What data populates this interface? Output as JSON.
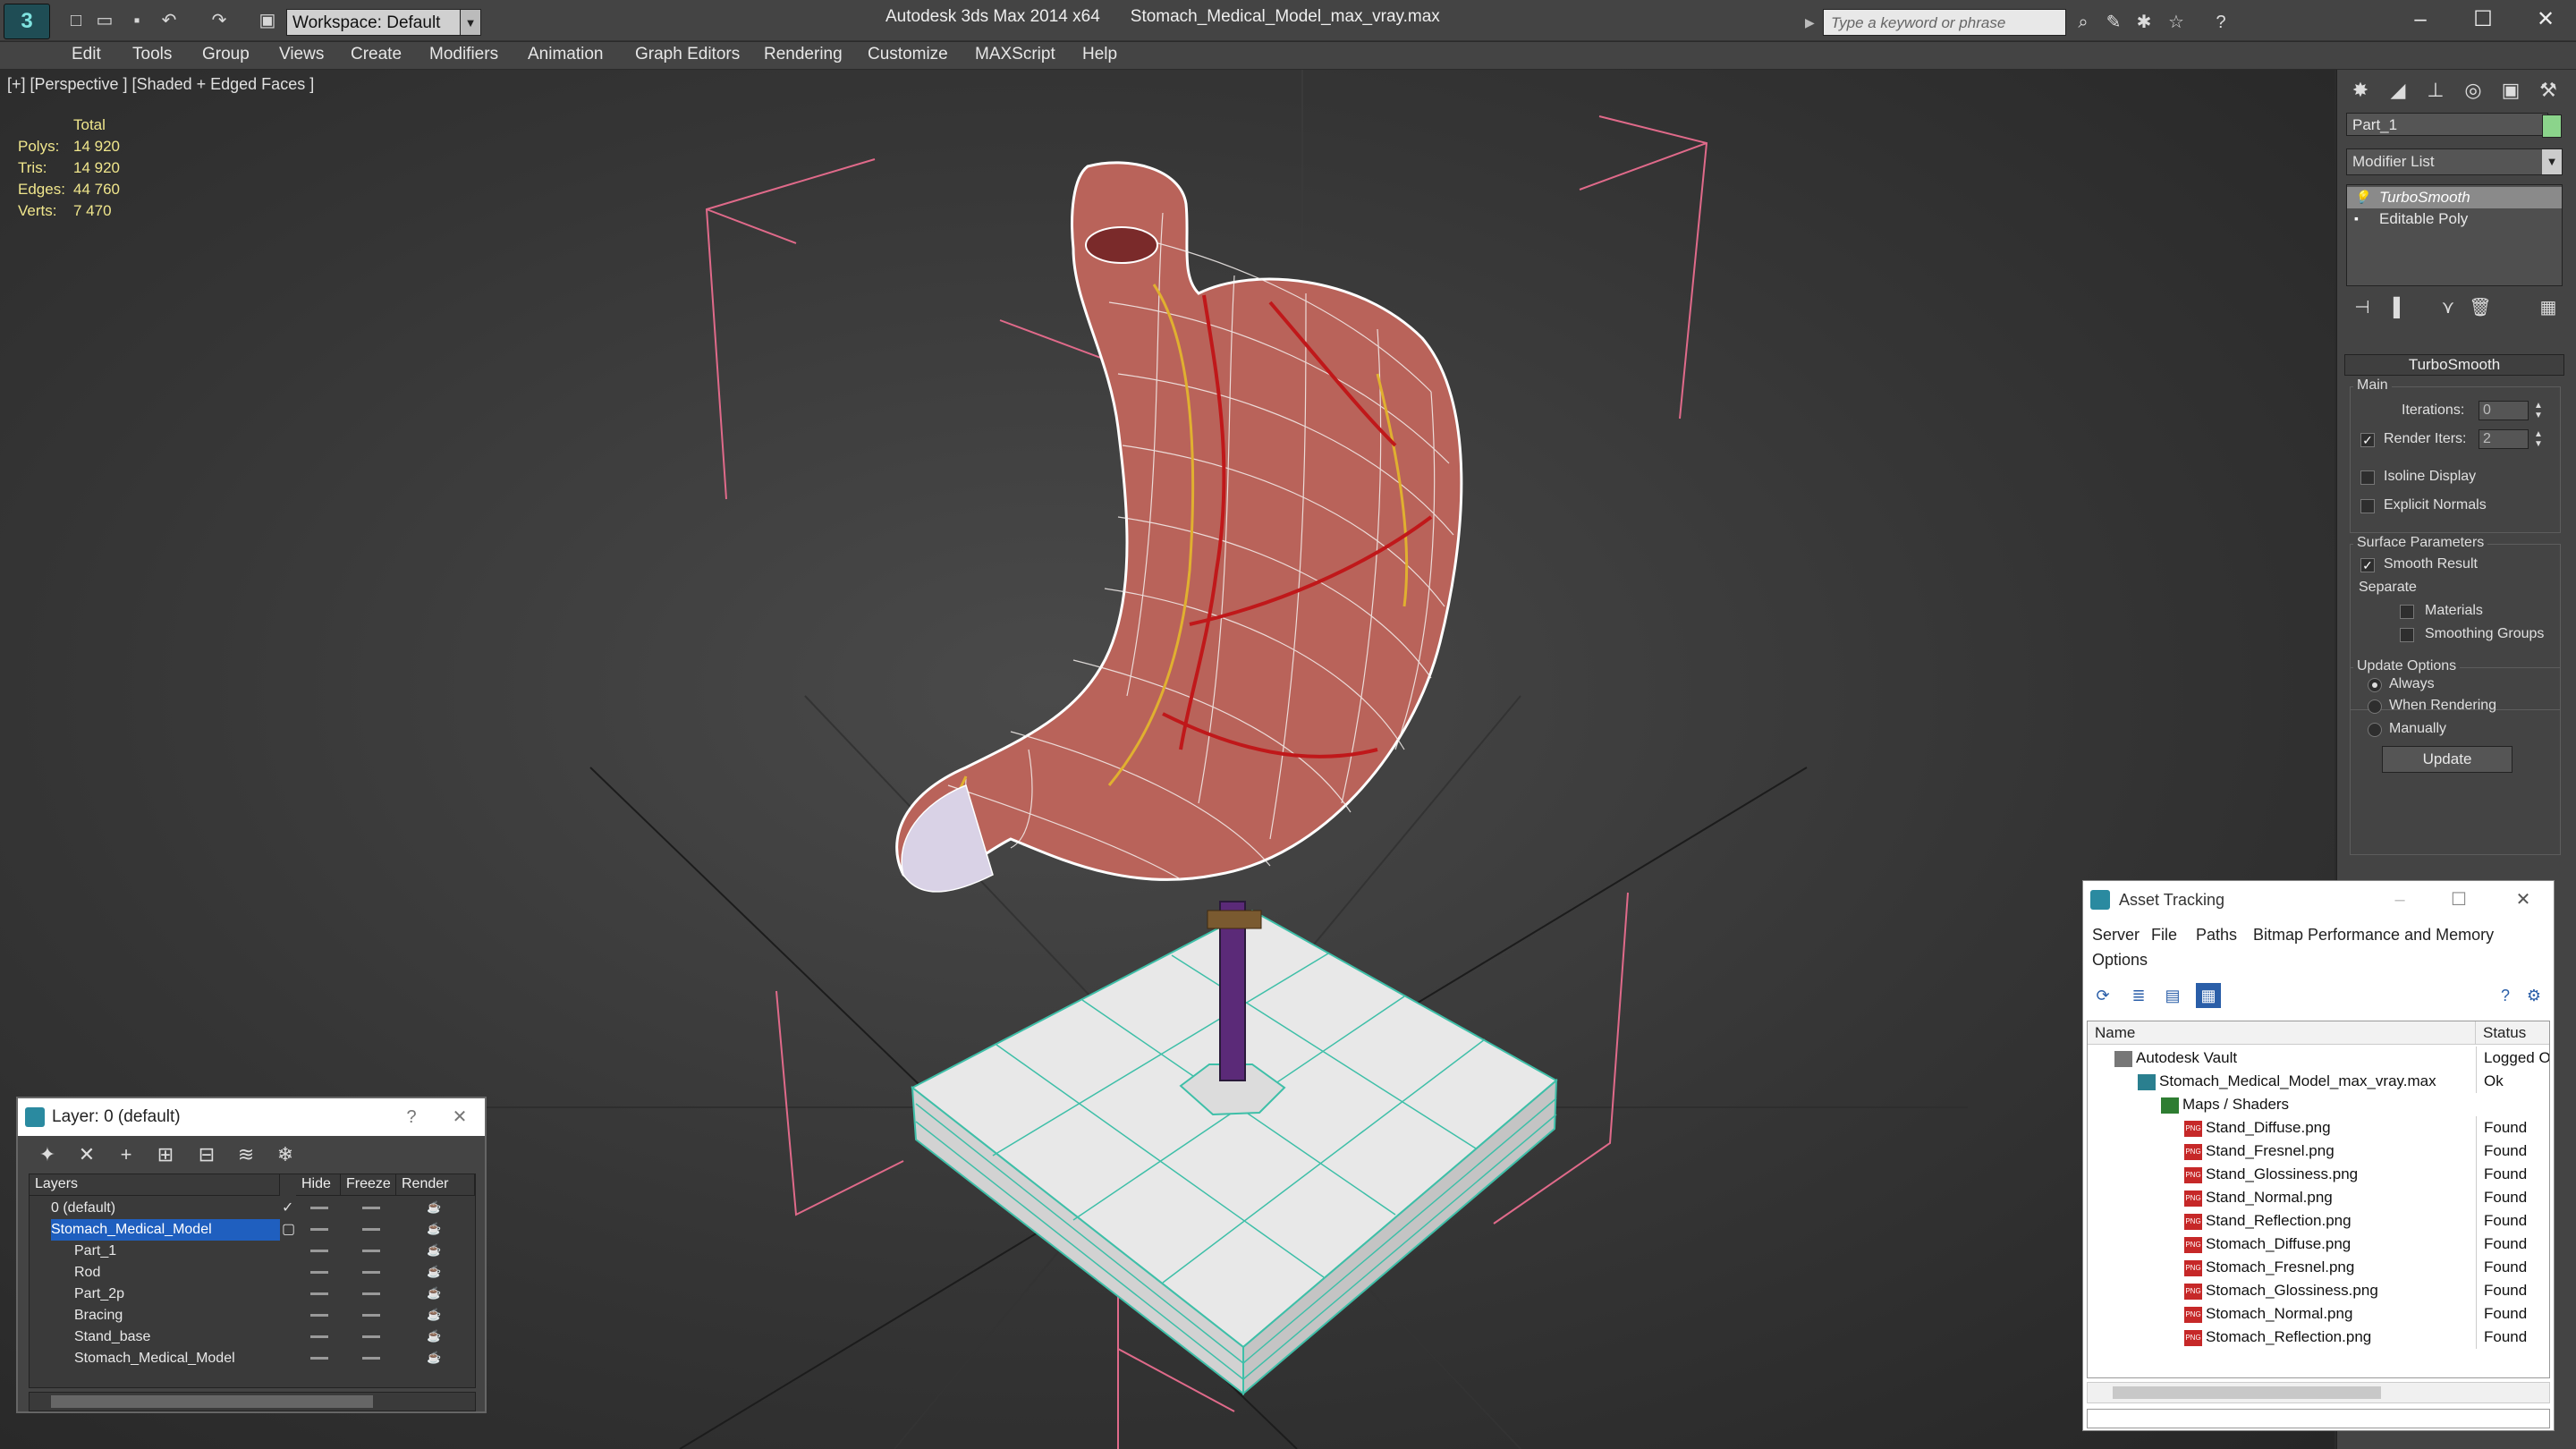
{
  "app": {
    "product": "Autodesk 3ds Max  2014 x64",
    "file": "Stomach_Medical_Model_max_vray.max",
    "workspace": "Workspace: Default",
    "search_placeholder": "Type a keyword or phrase"
  },
  "menu": [
    "Edit",
    "Tools",
    "Group",
    "Views",
    "Create",
    "Modifiers",
    "Animation",
    "Graph Editors",
    "Rendering",
    "Customize",
    "MAXScript",
    "Help"
  ],
  "viewport": {
    "label": "[+] [Perspective ] [Shaded + Edged Faces ]",
    "stats": {
      "header": "Total",
      "rows": [
        {
          "key": "Polys:",
          "value": "14 920"
        },
        {
          "key": "Tris:",
          "value": "14 920"
        },
        {
          "key": "Edges:",
          "value": "44 760"
        },
        {
          "key": "Verts:",
          "value": "7 470"
        }
      ]
    }
  },
  "command_panel": {
    "object_name": "Part_1",
    "object_color": "#8bd48b",
    "modifier_list": "Modifier List",
    "stack": [
      "TurboSmooth",
      "Editable Poly"
    ],
    "rollout": "TurboSmooth",
    "main_group": "Main",
    "iterations_label": "Iterations:",
    "iterations_value": "0",
    "render_iters_label": "Render Iters:",
    "render_iters_value": "2",
    "isoline": "Isoline Display",
    "explicit": "Explicit Normals",
    "surface_group": "Surface Parameters",
    "smooth_result": "Smooth Result",
    "separate": "Separate",
    "materials": "Materials",
    "smoothing_groups": "Smoothing Groups",
    "update_group": "Update Options",
    "always": "Always",
    "when_rendering": "When Rendering",
    "manually": "Manually",
    "update_button": "Update"
  },
  "layer_dialog": {
    "title": "Layer: 0 (default)",
    "help": "?",
    "columns": [
      "Layers",
      "Hide",
      "Freeze",
      "Render"
    ],
    "rows": [
      {
        "name": "0 (default)",
        "indent": 1,
        "selected": false
      },
      {
        "name": "Stomach_Medical_Model",
        "indent": 1,
        "selected": true
      },
      {
        "name": "Part_1",
        "indent": 2,
        "selected": false
      },
      {
        "name": "Rod",
        "indent": 2,
        "selected": false
      },
      {
        "name": "Part_2p",
        "indent": 2,
        "selected": false
      },
      {
        "name": "Bracing",
        "indent": 2,
        "selected": false
      },
      {
        "name": "Stand_base",
        "indent": 2,
        "selected": false
      },
      {
        "name": "Stomach_Medical_Model",
        "indent": 2,
        "selected": false
      }
    ]
  },
  "asset_dialog": {
    "title": "Asset Tracking",
    "menu": [
      "Server",
      "File",
      "Paths",
      "Bitmap Performance and Memory",
      "Options"
    ],
    "columns": [
      "Name",
      "Status"
    ],
    "rows": [
      {
        "name": "Autodesk Vault",
        "status": "Logged O",
        "indent": 0,
        "icon": "vault"
      },
      {
        "name": "Stomach_Medical_Model_max_vray.max",
        "status": "Ok",
        "indent": 1,
        "icon": "max"
      },
      {
        "name": "Maps / Shaders",
        "status": "",
        "indent": 2,
        "icon": "maps"
      },
      {
        "name": "Stand_Diffuse.png",
        "status": "Found",
        "indent": 3,
        "icon": "png"
      },
      {
        "name": "Stand_Fresnel.png",
        "status": "Found",
        "indent": 3,
        "icon": "png"
      },
      {
        "name": "Stand_Glossiness.png",
        "status": "Found",
        "indent": 3,
        "icon": "png"
      },
      {
        "name": "Stand_Normal.png",
        "status": "Found",
        "indent": 3,
        "icon": "png"
      },
      {
        "name": "Stand_Reflection.png",
        "status": "Found",
        "indent": 3,
        "icon": "png"
      },
      {
        "name": "Stomach_Diffuse.png",
        "status": "Found",
        "indent": 3,
        "icon": "png"
      },
      {
        "name": "Stomach_Fresnel.png",
        "status": "Found",
        "indent": 3,
        "icon": "png"
      },
      {
        "name": "Stomach_Glossiness.png",
        "status": "Found",
        "indent": 3,
        "icon": "png"
      },
      {
        "name": "Stomach_Normal.png",
        "status": "Found",
        "indent": 3,
        "icon": "png"
      },
      {
        "name": "Stomach_Reflection.png",
        "status": "Found",
        "indent": 3,
        "icon": "png"
      }
    ]
  }
}
